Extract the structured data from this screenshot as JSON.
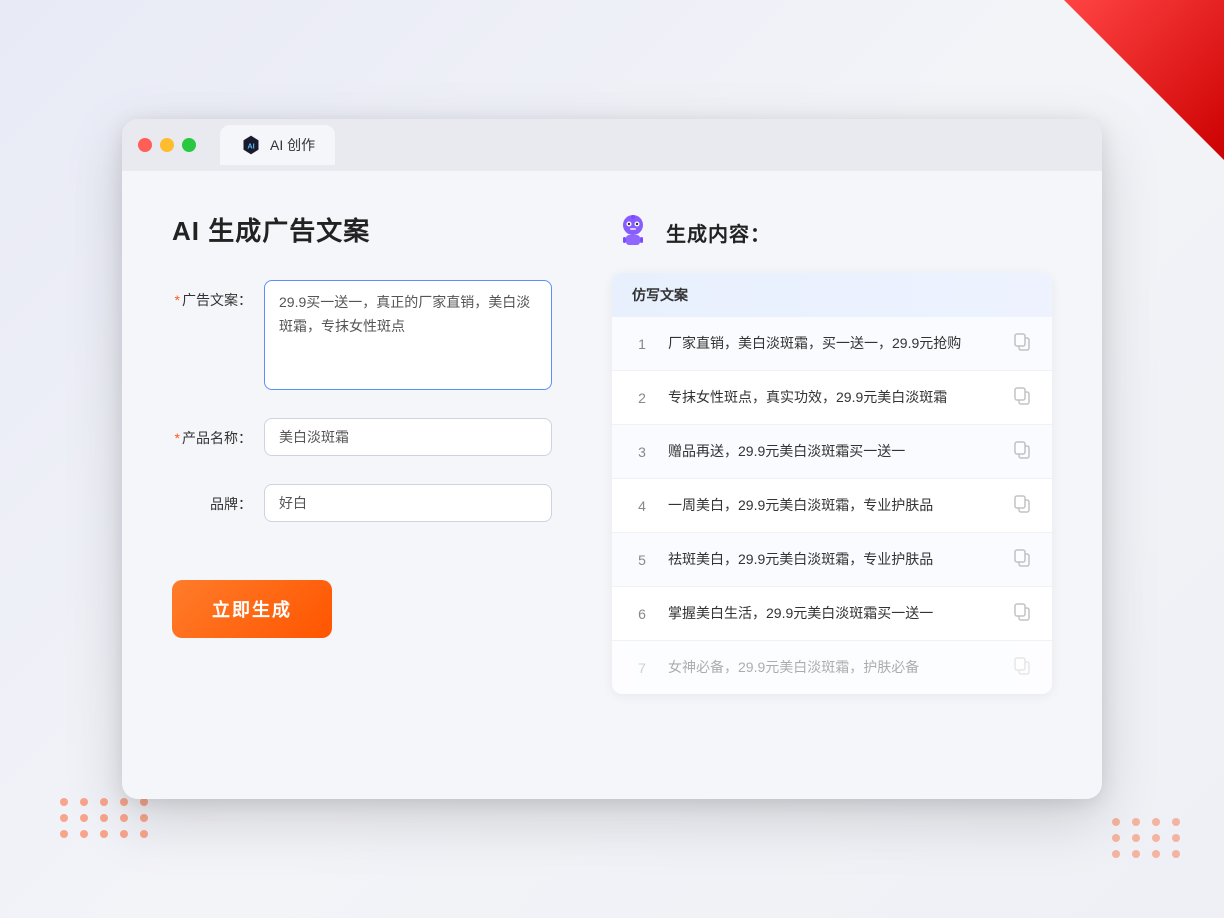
{
  "browser": {
    "tab_label": "AI 创作",
    "traffic_lights": [
      "red",
      "yellow",
      "green"
    ]
  },
  "page": {
    "title": "AI 生成广告文案",
    "form": {
      "ad_copy_label": "广告文案：",
      "ad_copy_required": "*",
      "ad_copy_value": "29.9买一送一，真正的厂家直销，美白淡斑霜，专抹女性斑点",
      "product_name_label": "产品名称：",
      "product_name_required": "*",
      "product_name_value": "美白淡斑霜",
      "brand_label": "品牌：",
      "brand_value": "好白",
      "generate_button_label": "立即生成"
    },
    "result": {
      "header_label": "生成内容：",
      "table_column_header": "仿写文案",
      "rows": [
        {
          "num": "1",
          "text": "厂家直销，美白淡斑霜，买一送一，29.9元抢购"
        },
        {
          "num": "2",
          "text": "专抹女性斑点，真实功效，29.9元美白淡斑霜"
        },
        {
          "num": "3",
          "text": "赠品再送，29.9元美白淡斑霜买一送一"
        },
        {
          "num": "4",
          "text": "一周美白，29.9元美白淡斑霜，专业护肤品"
        },
        {
          "num": "5",
          "text": "祛斑美白，29.9元美白淡斑霜，专业护肤品"
        },
        {
          "num": "6",
          "text": "掌握美白生活，29.9元美白淡斑霜买一送一"
        },
        {
          "num": "7",
          "text": "女神必备，29.9元美白淡斑霜，护肤必备"
        }
      ]
    }
  }
}
